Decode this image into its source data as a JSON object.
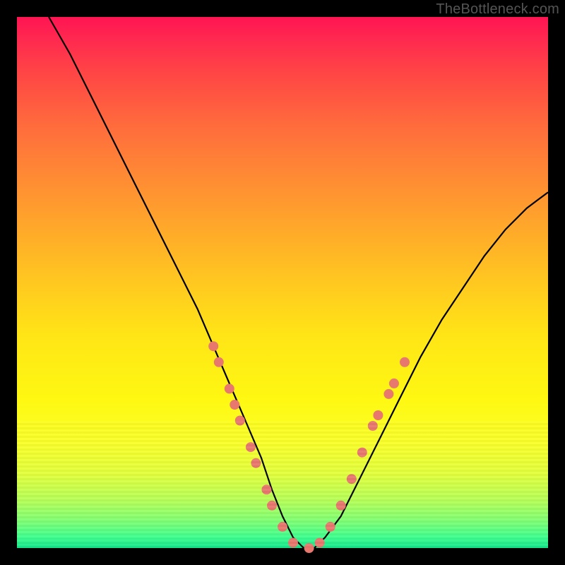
{
  "watermark": "TheBottleneck.com",
  "chart_data": {
    "type": "line",
    "title": "",
    "xlabel": "",
    "ylabel": "",
    "xlim": [
      0,
      100
    ],
    "ylim": [
      0,
      100
    ],
    "series": [
      {
        "name": "bottleneck-curve",
        "x": [
          6,
          10,
          14,
          18,
          22,
          26,
          30,
          34,
          37,
          40,
          43,
          46,
          48,
          50,
          52,
          54,
          56,
          58,
          61,
          64,
          68,
          72,
          76,
          80,
          84,
          88,
          92,
          96,
          100
        ],
        "values": [
          100,
          93,
          85,
          77,
          69,
          61,
          53,
          45,
          38,
          31,
          24,
          17,
          11,
          6,
          2,
          0,
          0,
          2,
          6,
          12,
          20,
          28,
          36,
          43,
          49,
          55,
          60,
          64,
          67
        ]
      }
    ],
    "markers": {
      "name": "salmon-dots",
      "color": "#e8776e",
      "points": [
        {
          "x": 37,
          "y": 38
        },
        {
          "x": 38,
          "y": 35
        },
        {
          "x": 40,
          "y": 30
        },
        {
          "x": 41,
          "y": 27
        },
        {
          "x": 42,
          "y": 24
        },
        {
          "x": 44,
          "y": 19
        },
        {
          "x": 45,
          "y": 16
        },
        {
          "x": 47,
          "y": 11
        },
        {
          "x": 48,
          "y": 8
        },
        {
          "x": 50,
          "y": 4
        },
        {
          "x": 52,
          "y": 1
        },
        {
          "x": 55,
          "y": 0
        },
        {
          "x": 57,
          "y": 1
        },
        {
          "x": 59,
          "y": 4
        },
        {
          "x": 61,
          "y": 8
        },
        {
          "x": 63,
          "y": 13
        },
        {
          "x": 65,
          "y": 18
        },
        {
          "x": 67,
          "y": 23
        },
        {
          "x": 68,
          "y": 25
        },
        {
          "x": 70,
          "y": 29
        },
        {
          "x": 71,
          "y": 31
        },
        {
          "x": 73,
          "y": 35
        }
      ]
    }
  }
}
